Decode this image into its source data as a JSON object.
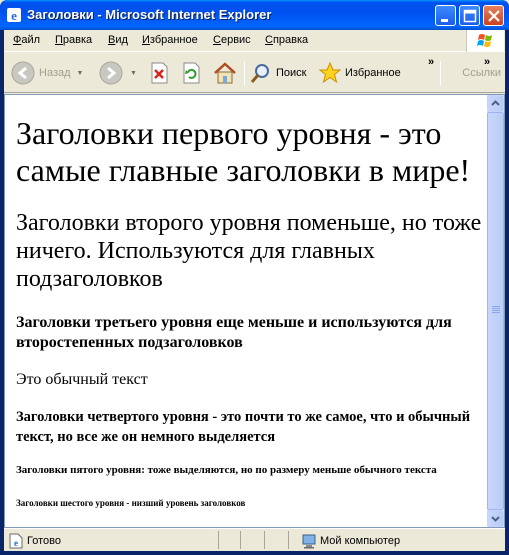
{
  "window": {
    "title": "Заголовки - Microsoft Internet Explorer"
  },
  "menu": [
    "Файл",
    "Правка",
    "Вид",
    "Избранное",
    "Сервис",
    "Справка"
  ],
  "toolbar": {
    "back_label": "Назад",
    "search_label": "Поиск",
    "favorites_label": "Избранное",
    "links_label": "Ссылки",
    "more_glyph": "»"
  },
  "page": {
    "h1": "Заголовки первого уровня - это самые главные заголовки в мире!",
    "h2": "Заголовки второго уровня поменьше, но тоже ничего. Используются для главных подзаголовков",
    "h3": "Заголовки третьего уровня еще меньше и используются для второстепенных подзаголовков",
    "p": "Это обычный текст",
    "h4": "Заголовки четвертого уровня - это почти то же самое, что и обычный текст, но все же он немного выделяется",
    "h5": "Заголовки пятого уровня: тоже выделяются, но по размеру меньше обычного текста",
    "h6": "Заголовки шестого уровня - низший уровень заголовков"
  },
  "status": {
    "left": "Готово",
    "zone": "Мой компьютер"
  },
  "colors": {
    "titlebar": "#0053EE",
    "chrome": "#ECE9D8",
    "close_button": "#C9441E"
  }
}
